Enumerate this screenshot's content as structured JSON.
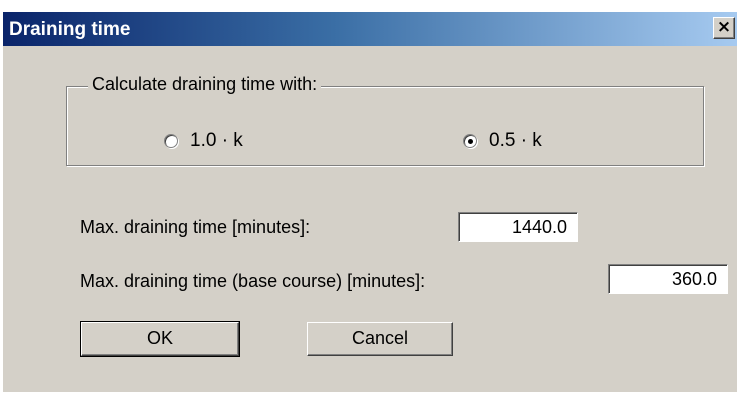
{
  "dialog": {
    "title": "Draining time",
    "close_glyph": "×"
  },
  "calc_group": {
    "label": "Calculate draining time with:",
    "options": [
      {
        "label": "1.0 · k",
        "checked": false
      },
      {
        "label": "0.5 · k",
        "checked": true
      }
    ]
  },
  "fields": {
    "max_time_label": "Max. draining time [minutes]:",
    "max_time_value": "1440.0",
    "max_time_base_label": "Max. draining time (base course) [minutes]:",
    "max_time_base_value": "360.0"
  },
  "buttons": {
    "ok": "OK",
    "cancel": "Cancel"
  },
  "icons": {
    "close": "close-icon",
    "radio": "radio-icon"
  },
  "colors": {
    "dialog_bg": "#d4d0c8",
    "title_gradient_start": "#0a246a",
    "title_gradient_end": "#a6caf0"
  }
}
